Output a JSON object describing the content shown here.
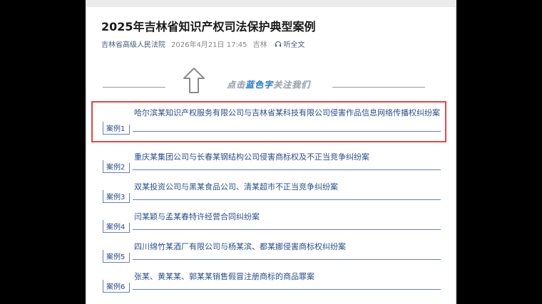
{
  "article": {
    "title": "2025年吉林省知识产权司法保护典型案例",
    "source": "吉林省高级人民法院",
    "date": "2026年4月21日 17:45",
    "location": "吉林",
    "listen_label": "听全文"
  },
  "follow_banner": {
    "text_before": "点击",
    "text_highlight": "蓝色字",
    "text_after": "关注我们"
  },
  "cases": [
    {
      "tag": "案例1",
      "title": "哈尔滨某知识产权服务有限公司与吉林省某科技有限公司侵害作品信息网络传播权纠纷案"
    },
    {
      "tag": "案例2",
      "title": "重庆某集团公司与长春某钢结构公司侵害商标权及不正当竞争纠纷案"
    },
    {
      "tag": "案例3",
      "title": "双某投资公司与黑某食品公司、清某超市不正当竞争纠纷案"
    },
    {
      "tag": "案例4",
      "title": "闫某颖与孟某春特许经营合同纠纷案"
    },
    {
      "tag": "案例5",
      "title": "四川绵竹某酒厂有限公司与杨某滨、都某娜侵害商标权纠纷案"
    },
    {
      "tag": "案例6",
      "title": "张某、黄某某、郭某某销售假冒注册商标的商品罪案"
    }
  ],
  "colors": {
    "highlight_border": "#e04848",
    "link": "#2b4d8a",
    "accent_blue": "#2f7fd0"
  }
}
